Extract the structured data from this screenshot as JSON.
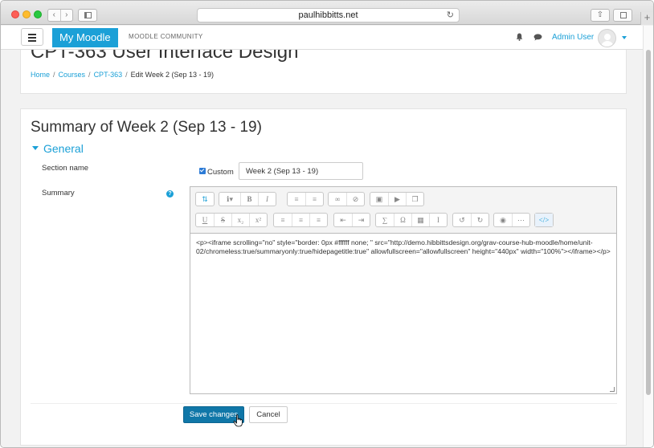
{
  "browser": {
    "url": "paulhibbitts.net"
  },
  "navbar": {
    "brand": "My Moodle",
    "community": "MOODLE COMMUNITY",
    "user_name": "Admin User"
  },
  "header": {
    "course_title": "CPT-363 User Interface Design",
    "breadcrumb": {
      "home": "Home",
      "courses": "Courses",
      "course": "CPT-363",
      "current": "Edit Week 2 (Sep 13 - 19)",
      "separator": "/"
    }
  },
  "form": {
    "page_title": "Summary of Week 2 (Sep 13 - 19)",
    "section_header": "General",
    "section_name_label": "Section name",
    "custom_label": "Custom",
    "custom_checked": true,
    "section_name_value": "Week 2 (Sep 13 - 19)",
    "summary_label": "Summary",
    "help_glyph": "?",
    "summary_source": "<p><iframe scrolling=\"no\" style=\"border: 0px #ffffff none; \" src=\"http://demo.hibbittsdesign.org/grav-course-hub-moodle/home/unit-02/chromeless:true/summaryonly:true/hidepagetitle:true\" allowfullscreen=\"allowfullscreen\" height=\"440px\" width=\"100%\"></iframe></p>",
    "save_label": "Save changes",
    "cancel_label": "Cancel"
  },
  "toolbar_icons": {
    "row1": [
      [
        "toggle-toolbar-icon"
      ],
      [
        "paragraph-styles-icon",
        "bold-icon",
        "italic-icon"
      ],
      [
        "unordered-list-icon",
        "ordered-list-icon"
      ],
      [
        "link-icon",
        "unlink-icon"
      ],
      [
        "image-icon",
        "media-icon",
        "manage-files-icon"
      ]
    ],
    "row2": [
      [
        "underline-icon",
        "strikethrough-icon",
        "subscript-icon",
        "superscript-icon"
      ],
      [
        "align-left-icon",
        "align-center-icon",
        "align-right-icon"
      ],
      [
        "outdent-icon",
        "indent-icon"
      ],
      [
        "equation-icon",
        "special-character-icon",
        "table-icon",
        "clear-formatting-icon"
      ],
      [
        "undo-icon",
        "redo-icon"
      ],
      [
        "accessibility-checker-icon",
        "screenreader-helper-icon"
      ],
      [
        "html-source-icon"
      ]
    ]
  },
  "colors": {
    "accent": "#1ba0d7",
    "primary_button": "#1077a8",
    "checkbox": "#2d7bd6"
  }
}
